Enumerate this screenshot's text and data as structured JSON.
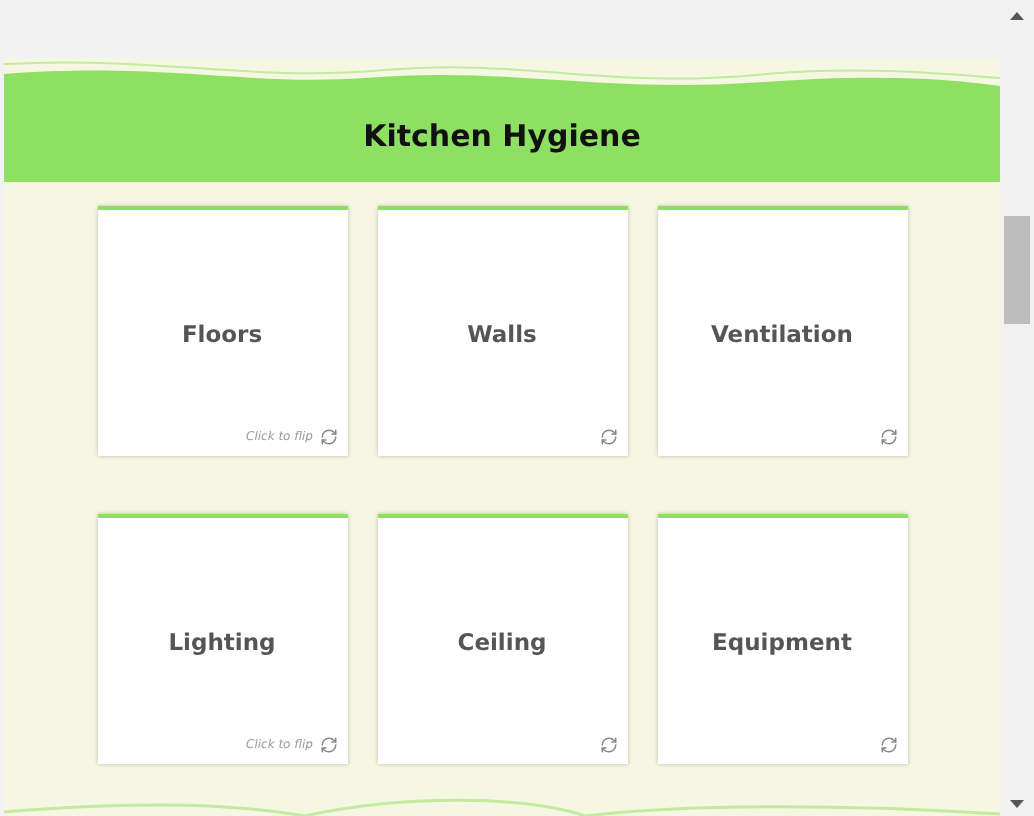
{
  "header": {
    "title": "Kitchen Hygiene"
  },
  "cards": [
    {
      "label": "Floors",
      "hint": "Click to flip"
    },
    {
      "label": "Walls"
    },
    {
      "label": "Ventilation"
    },
    {
      "label": "Lighting",
      "hint": "Click to flip"
    },
    {
      "label": "Ceiling"
    },
    {
      "label": "Equipment"
    }
  ]
}
